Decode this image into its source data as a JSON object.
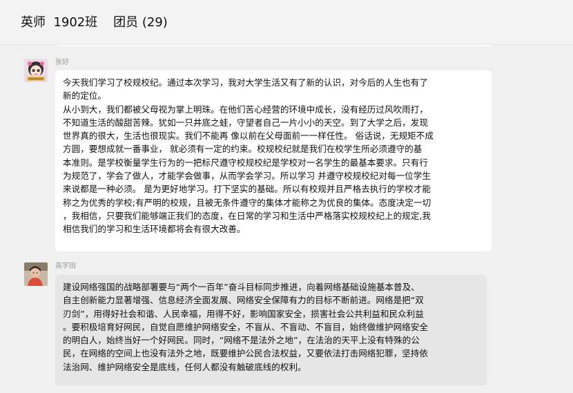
{
  "header": {
    "title": "英师  1902班    团员 (29)"
  },
  "messages": [
    {
      "sender": "张好",
      "avatar_icon": "cartoon-girl-avatar",
      "lines": [
        "今天我们学习了校规校纪。通过本次学习，我对大学生活又有了新的认识，对今后的人生也有了",
        "新的定位。",
        "从小到大，我们都被父母视为掌上明珠。在他们苦心经营的环境中成长，没有经历过风吹雨打，",
        "不知道生活的酸甜苦辣。犹如一只井底之蛙，守望者自己一片小小的天空。到了大学之后，发现",
        "世界真的很大，生活也很现实。我们不能再 像以前在父母面前一一样任性。 俗话说，无规矩不成",
        "方圆，要想成就一番事业， 就必须有一定的约束。校规校纪就是我们在校学生所必须遵守的基",
        "本准则。是学校衡量学生行为的一把标尺遵守校规校纪是学校对一名学生的最基本要求。只有行",
        "为规范了，学会了做人，才能学会做事，从而学会学习。所以学习 并遵守校规校纪对每一位学生",
        "来说都是一种必须。 是为更好地学习。打下坚实的基础。所以有校规并且严格去执行的学校才能",
        "称之为优秀的学校;有严明的校规，且被无条件遵守的集体才能称之为优良的集体。态度决定一切",
        "，我相信，只要我们能够端正我们的态度，在日常的学习和生活中严格落实校规校纪上的规定,我",
        "相信我们的学习和生活环境都将会有很大改善。"
      ]
    },
    {
      "sender": "高宇田",
      "avatar_icon": "person-photo-avatar",
      "lines": [
        "建设网络强国的战略部署要与“两个一百年”奋斗目标同步推进，向着网络基础设施基本普及、",
        "自主创新能力显著增强、信息经济全面发展、网络安全保障有力的目标不断前进。网络是把“双",
        "刃剑”，用得好社会和谐、人民幸福，用得不好，影响国家安全，损害社会公共利益和民众利益",
        "。要积极培育好网民，自觉自愿维护网络安全，不盲从、不盲动、不盲目，始终做维护网络安全",
        "的明白人，始终当好一个好网民。同时，“网络不是法外之地”，在法治的天平上没有特殊的公",
        "民，在网络的空间上也没有法外之地，既要维护公民合法权益，又要依法打击网络犯罪，坚持依",
        "法治网、维护网络安全是底线，任何人都没有触破底线的权利。"
      ]
    }
  ]
}
